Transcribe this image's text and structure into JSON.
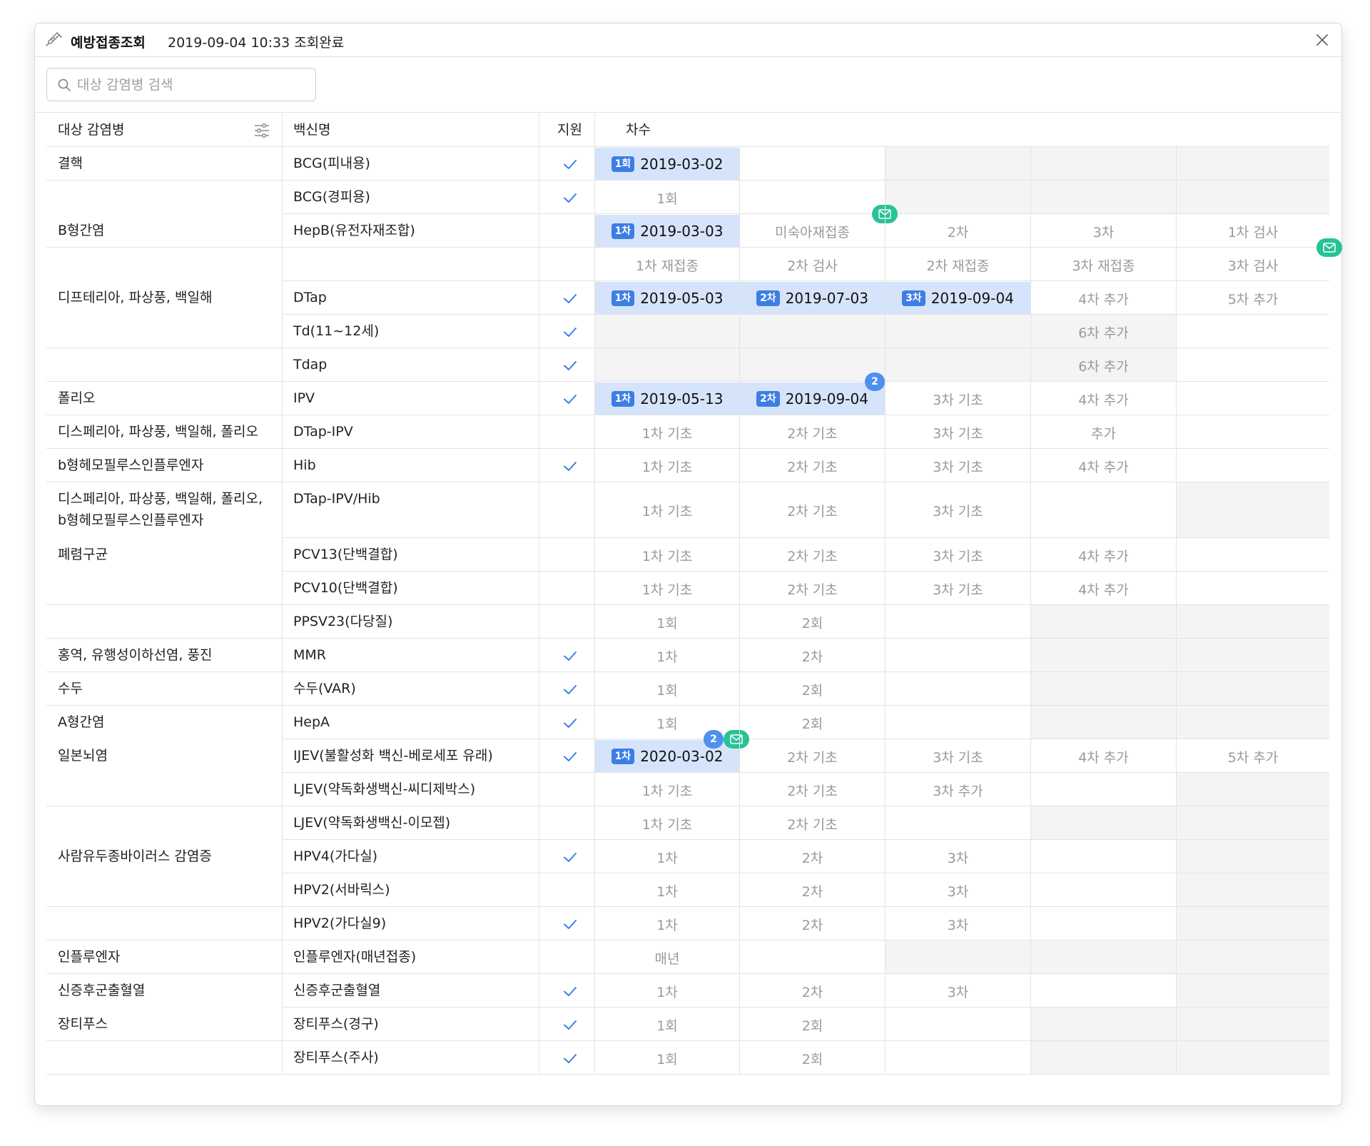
{
  "window": {
    "title": "예방접종조회",
    "status": "2019-09-04 10:33 조회완료",
    "title_icon": "syringe-icon",
    "close_icon": "close-icon"
  },
  "search": {
    "placeholder": "대상 감염병 검색",
    "value": ""
  },
  "columns": {
    "disease": "대상 감염병",
    "vaccine": "백신명",
    "support": "지원",
    "dose": "차수"
  },
  "colors": {
    "accent": "#3d7ee5",
    "done_bg": "#d6e4fb",
    "mail_badge": "#27c296",
    "count_badge": "#4d90f0",
    "check": "#3d7ee5"
  },
  "rows": [
    {
      "disease": "결핵",
      "vaccine": "BCG(피내용)",
      "supported": true,
      "doses": [
        {
          "badge": "1회",
          "date": "2019-03-02",
          "done": true
        }
      ]
    },
    {
      "disease": "",
      "vaccine": "BCG(경피용)",
      "supported": true,
      "doses": [
        {
          "label": "1회"
        }
      ]
    },
    {
      "disease": "B형간염",
      "vaccine": "HepB(유전자재조합)",
      "supported": false,
      "doses": [
        {
          "badge": "1차",
          "date": "2019-03-03",
          "done": true
        },
        {
          "label": "미숙아재접종",
          "mail": true
        },
        {
          "label": "2차"
        },
        {
          "label": "3차"
        },
        {
          "label": "1차 검사"
        }
      ]
    },
    {
      "disease": "",
      "vaccine": "",
      "supported": false,
      "doses": [
        {
          "label": "1차 재접종"
        },
        {
          "label": "2차 검사"
        },
        {
          "label": "2차 재접종"
        },
        {
          "label": "3차 재접종"
        },
        {
          "label": "3차 검사",
          "mail": true
        }
      ]
    },
    {
      "disease": "디프테리아, 파상풍, 백일해",
      "vaccine": "DTap",
      "supported": true,
      "doses": [
        {
          "badge": "1차",
          "date": "2019-05-03",
          "done": true
        },
        {
          "badge": "2차",
          "date": "2019-07-03",
          "done": true
        },
        {
          "badge": "3차",
          "date": "2019-09-04",
          "done": true
        },
        {
          "label": "4차 추가"
        },
        {
          "label": "5차 추가"
        }
      ]
    },
    {
      "disease": "",
      "vaccine": "Td(11~12세)",
      "supported": true,
      "doses": [
        {
          "label": "6차 추가"
        }
      ]
    },
    {
      "disease": "",
      "vaccine": "Tdap",
      "supported": true,
      "doses": [
        {
          "label": "6차 추가"
        }
      ]
    },
    {
      "disease": "폴리오",
      "vaccine": "IPV",
      "supported": true,
      "doses": [
        {
          "badge": "1차",
          "date": "2019-05-13",
          "done": true
        },
        {
          "badge": "2차",
          "date": "2019-09-04",
          "done": true,
          "count": "2"
        },
        {
          "label": "3차 기초"
        },
        {
          "label": "4차 추가"
        }
      ]
    },
    {
      "disease": "디스페리아, 파상풍, 백일해, 폴리오",
      "vaccine": "DTap-IPV",
      "supported": false,
      "doses": [
        {
          "label": "1차 기초"
        },
        {
          "label": "2차 기초"
        },
        {
          "label": "3차 기초"
        },
        {
          "label": "추가"
        }
      ]
    },
    {
      "disease": "b형헤모필루스인플루엔자",
      "vaccine": "Hib",
      "supported": true,
      "doses": [
        {
          "label": "1차 기초"
        },
        {
          "label": "2차 기초"
        },
        {
          "label": "3차 기초"
        },
        {
          "label": "4차 추가"
        }
      ]
    },
    {
      "disease": "디스페리아, 파상풍, 백일해, 폴리오,",
      "disease2": "b형헤모필루스인플루엔자",
      "vaccine": "DTap-IPV/Hib",
      "supported": false,
      "doses": [
        {
          "label": "1차 기초"
        },
        {
          "label": "2차 기초"
        },
        {
          "label": "3차 기초"
        }
      ]
    },
    {
      "disease": "폐렴구균",
      "vaccine": "PCV13(단백결합)",
      "supported": false,
      "doses": [
        {
          "label": "1차 기초"
        },
        {
          "label": "2차 기초"
        },
        {
          "label": "3차 기초"
        },
        {
          "label": "4차 추가"
        }
      ]
    },
    {
      "disease": "",
      "vaccine": "PCV10(단백결합)",
      "supported": false,
      "doses": [
        {
          "label": "1차 기초"
        },
        {
          "label": "2차 기초"
        },
        {
          "label": "3차 기초"
        },
        {
          "label": "4차 추가"
        }
      ]
    },
    {
      "disease": "",
      "vaccine": "PPSV23(다당질)",
      "supported": false,
      "doses": [
        {
          "label": "1회"
        },
        {
          "label": "2회"
        }
      ]
    },
    {
      "disease": "홍역, 유행성이하선염, 풍진",
      "vaccine": "MMR",
      "supported": true,
      "doses": [
        {
          "label": "1차"
        },
        {
          "label": "2차"
        }
      ]
    },
    {
      "disease": "수두",
      "vaccine": "수두(VAR)",
      "supported": true,
      "doses": [
        {
          "label": "1회"
        },
        {
          "label": "2회"
        }
      ]
    },
    {
      "disease": "A형간염",
      "vaccine": "HepA",
      "supported": true,
      "doses": [
        {
          "label": "1회"
        },
        {
          "label": "2회"
        }
      ]
    },
    {
      "disease": "일본뇌염",
      "vaccine": "IJEV(불활성화 백신-베로세포 유래)",
      "supported": true,
      "doses": [
        {
          "badge": "1차",
          "date": "2020-03-02",
          "done": true,
          "count": "2",
          "mail": true
        },
        {
          "label": "2차 기초"
        },
        {
          "label": "3차 기초"
        },
        {
          "label": "4차 추가"
        },
        {
          "label": "5차 추가"
        }
      ]
    },
    {
      "disease": "",
      "vaccine": "LJEV(약독화생백신-씨디제박스)",
      "supported": false,
      "doses": [
        {
          "label": "1차 기초"
        },
        {
          "label": "2차 기초"
        },
        {
          "label": "3차 추가"
        }
      ]
    },
    {
      "disease": "",
      "vaccine": "LJEV(약독화생백신-이모젭)",
      "supported": false,
      "doses": [
        {
          "label": "1차 기초"
        },
        {
          "label": "2차 기초"
        }
      ]
    },
    {
      "disease": "사람유두종바이러스 감염증",
      "vaccine": "HPV4(가다실)",
      "supported": true,
      "doses": [
        {
          "label": "1차"
        },
        {
          "label": "2차"
        },
        {
          "label": "3차"
        }
      ]
    },
    {
      "disease": "",
      "vaccine": "HPV2(서바릭스)",
      "supported": false,
      "doses": [
        {
          "label": "1차"
        },
        {
          "label": "2차"
        },
        {
          "label": "3차"
        }
      ]
    },
    {
      "disease": "",
      "vaccine": "HPV2(가다실9)",
      "supported": true,
      "doses": [
        {
          "label": "1차"
        },
        {
          "label": "2차"
        },
        {
          "label": "3차"
        }
      ]
    },
    {
      "disease": "인플루엔자",
      "vaccine": "인플루엔자(매년접종)",
      "supported": false,
      "doses": [
        {
          "label": "매년"
        }
      ]
    },
    {
      "disease": "신증후군출혈열",
      "vaccine": "신증후군출혈열",
      "supported": true,
      "doses": [
        {
          "label": "1차"
        },
        {
          "label": "2차"
        },
        {
          "label": "3차"
        }
      ]
    },
    {
      "disease": "장티푸스",
      "vaccine": "장티푸스(경구)",
      "supported": true,
      "doses": [
        {
          "label": "1회"
        },
        {
          "label": "2회"
        }
      ]
    },
    {
      "disease": "",
      "vaccine": "장티푸스(주사)",
      "supported": true,
      "doses": [
        {
          "label": "1회"
        },
        {
          "label": "2회"
        }
      ]
    }
  ]
}
